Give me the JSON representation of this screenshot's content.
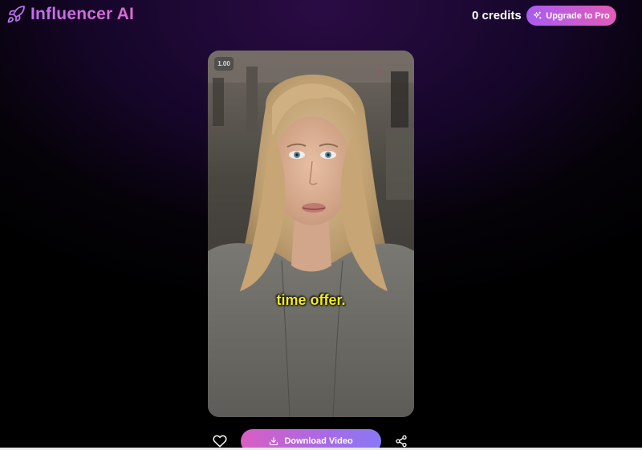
{
  "header": {
    "app_name": "Influencer AI",
    "logo_icon": "rocket-icon",
    "credits": "0 credits",
    "upgrade_label": "Upgrade to Pro",
    "upgrade_icon": "sparkles-icon"
  },
  "video": {
    "speed": "1.00",
    "caption": "time offer."
  },
  "actions": {
    "like_icon": "heart-icon",
    "download_label": "Download Video",
    "download_icon": "download-icon",
    "share_icon": "share-icon"
  },
  "colors": {
    "brand": "#c56cf0",
    "upgrade_gradient": [
      "#a85cf0",
      "#e35bb8"
    ],
    "download_gradient": [
      "#d85fc2",
      "#8a78f4"
    ],
    "caption": "#f5ec1a"
  }
}
